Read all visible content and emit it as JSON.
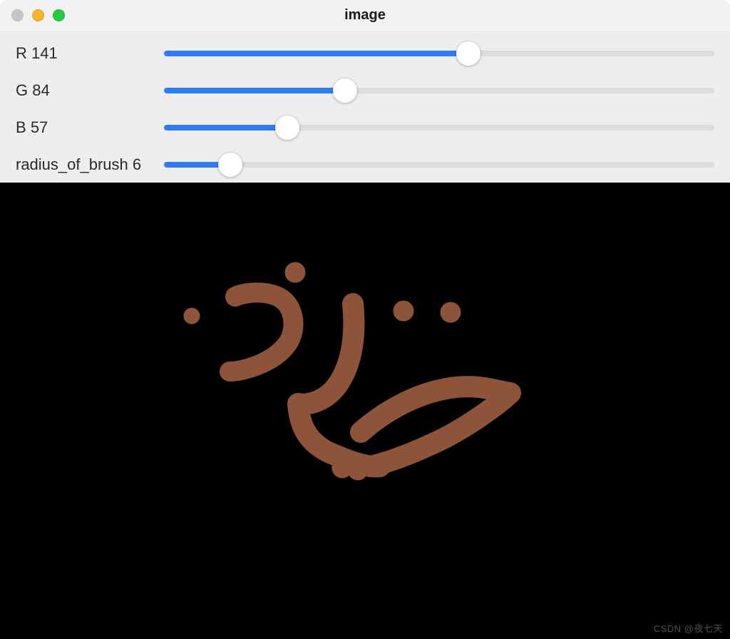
{
  "window": {
    "title": "image"
  },
  "sliders": [
    {
      "name": "R",
      "value": 141,
      "max": 255
    },
    {
      "name": "G",
      "value": 84,
      "max": 255
    },
    {
      "name": "B",
      "value": 57,
      "max": 255
    },
    {
      "name": "radius_of_brush",
      "value": 6,
      "max": 50
    }
  ],
  "brush_color": "#8d5439",
  "watermark": "CSDN @夜七天"
}
